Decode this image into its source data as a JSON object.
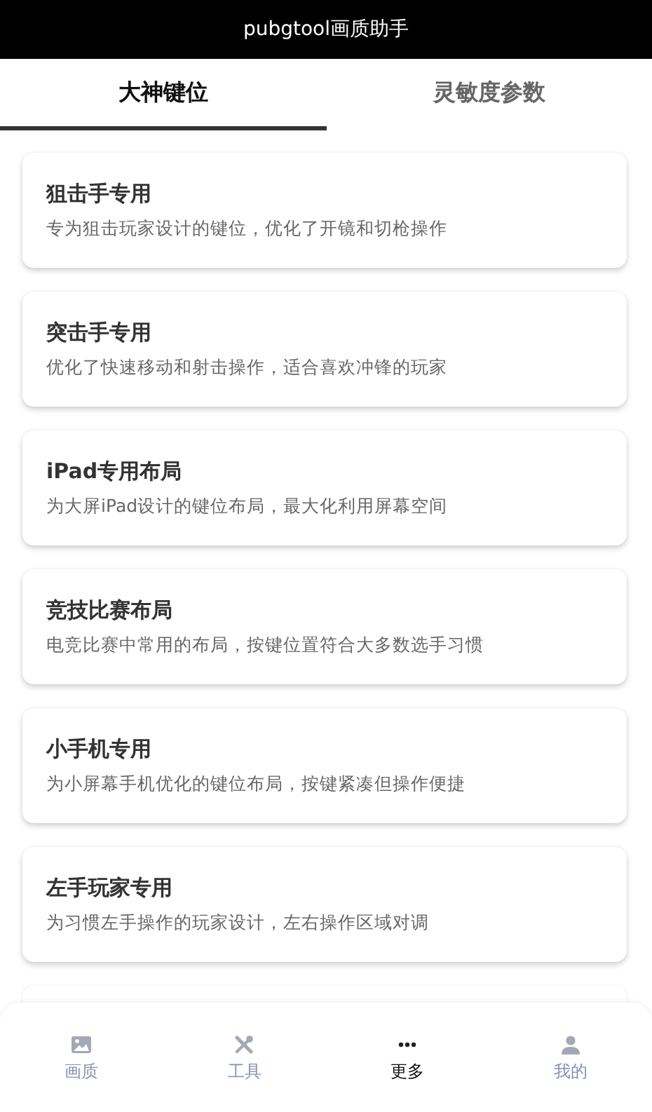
{
  "header": {
    "title": "pubgtool画质助手"
  },
  "tabs": [
    {
      "label": "大神键位",
      "selected": true
    },
    {
      "label": "灵敏度参数",
      "selected": false
    }
  ],
  "cards": [
    {
      "title": "狙击手专用",
      "description": "专为狙击玩家设计的键位，优化了开镜和切枪操作"
    },
    {
      "title": "突击手专用",
      "description": "优化了快速移动和射击操作，适合喜欢冲锋的玩家"
    },
    {
      "title": "iPad专用布局",
      "description": "为大屏iPad设计的键位布局，最大化利用屏幕空间"
    },
    {
      "title": "竞技比赛布局",
      "description": "电竞比赛中常用的布局，按键位置符合大多数选手习惯"
    },
    {
      "title": "小手机专用",
      "description": "为小屏幕手机优化的键位布局，按键紧凑但操作便捷"
    },
    {
      "title": "左手玩家专用",
      "description": "为习惯左手操作的玩家设计，左右操作区域对调"
    }
  ],
  "bottom_nav": [
    {
      "label": "画质",
      "selected": false
    },
    {
      "label": "工具",
      "selected": false
    },
    {
      "label": "更多",
      "selected": true
    },
    {
      "label": "我的",
      "selected": false
    }
  ]
}
